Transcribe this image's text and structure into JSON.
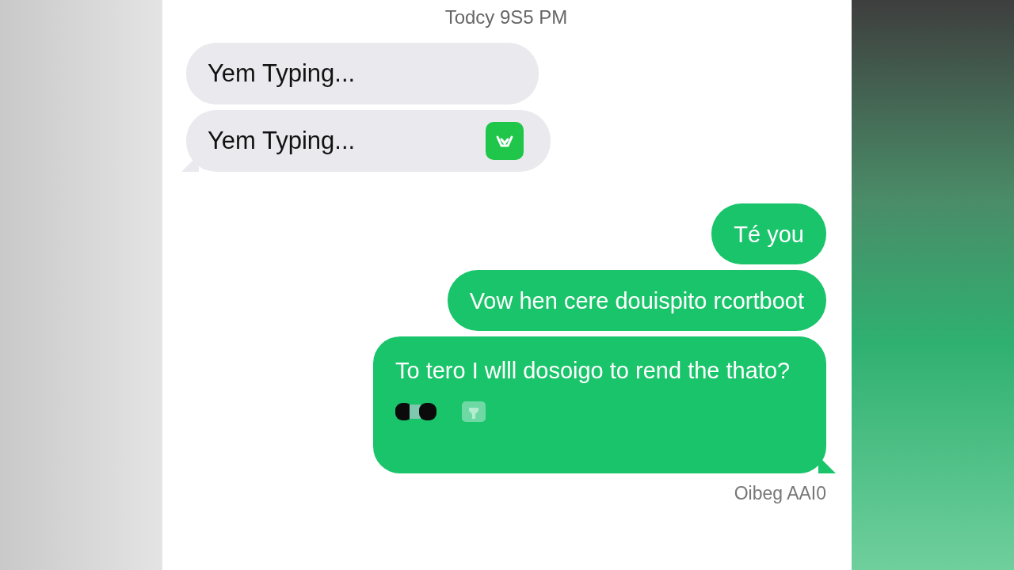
{
  "timestamp": "Todcy 9S5 PM",
  "messages": [
    {
      "kind": "received",
      "text": "Yem Typing...",
      "tail": false
    },
    {
      "kind": "received",
      "text": "Yem Typing...",
      "tail": true,
      "attachments": [
        {
          "kind": "app-icon"
        }
      ]
    },
    {
      "kind": "sent",
      "text": "Té you",
      "tail": false
    },
    {
      "kind": "sent",
      "text": "Vow hen cere douispito rcortboot",
      "tail": false
    },
    {
      "kind": "sent",
      "text": "To tero I wlll dosoigo to rend the thato?",
      "tail": true,
      "attachments": [
        {
          "kind": "dots"
        },
        {
          "kind": "photo"
        }
      ]
    }
  ],
  "status": "Oibeg AAI0"
}
